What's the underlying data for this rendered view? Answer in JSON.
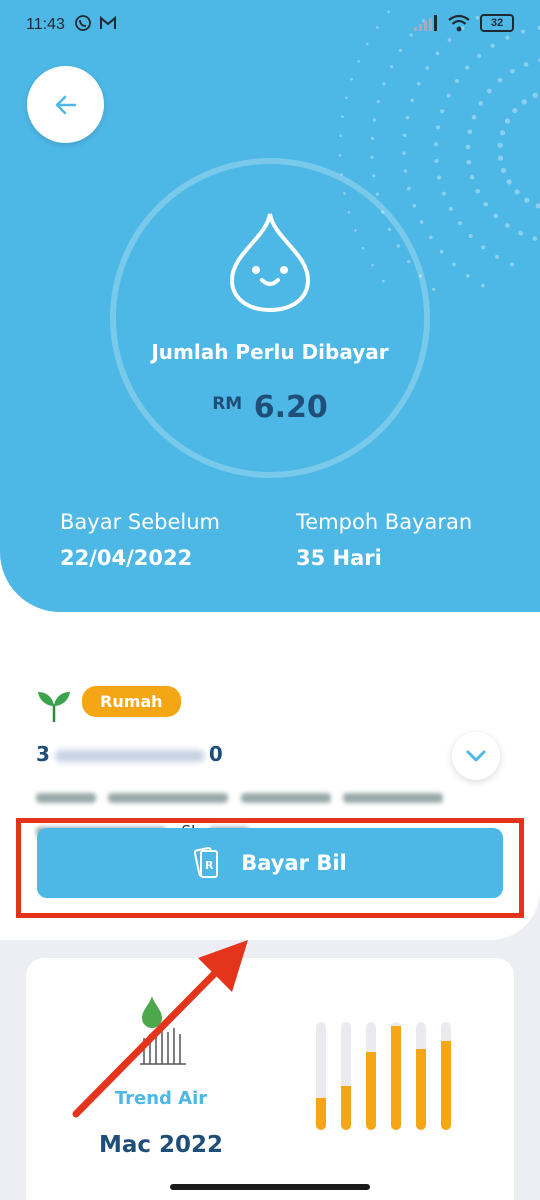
{
  "status": {
    "time": "11:43",
    "battery": "32"
  },
  "hero": {
    "amount_title": "Jumlah Perlu Dibayar",
    "currency": "RM",
    "amount": "6.20",
    "due_label": "Bayar Sebelum",
    "due_value": "22/04/2022",
    "period_label": "Tempoh Bayaran",
    "period_value": "35 Hari"
  },
  "account": {
    "type_badge": "Rumah",
    "number_start": "3",
    "number_end": "0",
    "address_line2_tail": ", SL,"
  },
  "pay_button": {
    "label": "Bayar Bil"
  },
  "trend": {
    "label": "Trend Air",
    "month": "Mac 2022",
    "bar_levels": [
      0.3,
      0.41,
      0.72,
      0.96,
      0.75,
      0.82
    ]
  },
  "colors": {
    "primary": "#4db7e5",
    "accent": "#f5a614",
    "navy": "#1f4e79",
    "highlight": "#e4341c"
  },
  "icons": [
    "back-arrow-icon",
    "water-drop-icon",
    "plant-icon",
    "chevron-down-icon",
    "cash-icon",
    "water-level-icon",
    "whatsapp-icon",
    "gmail-icon",
    "signal-icon",
    "wifi-icon",
    "battery-icon"
  ]
}
